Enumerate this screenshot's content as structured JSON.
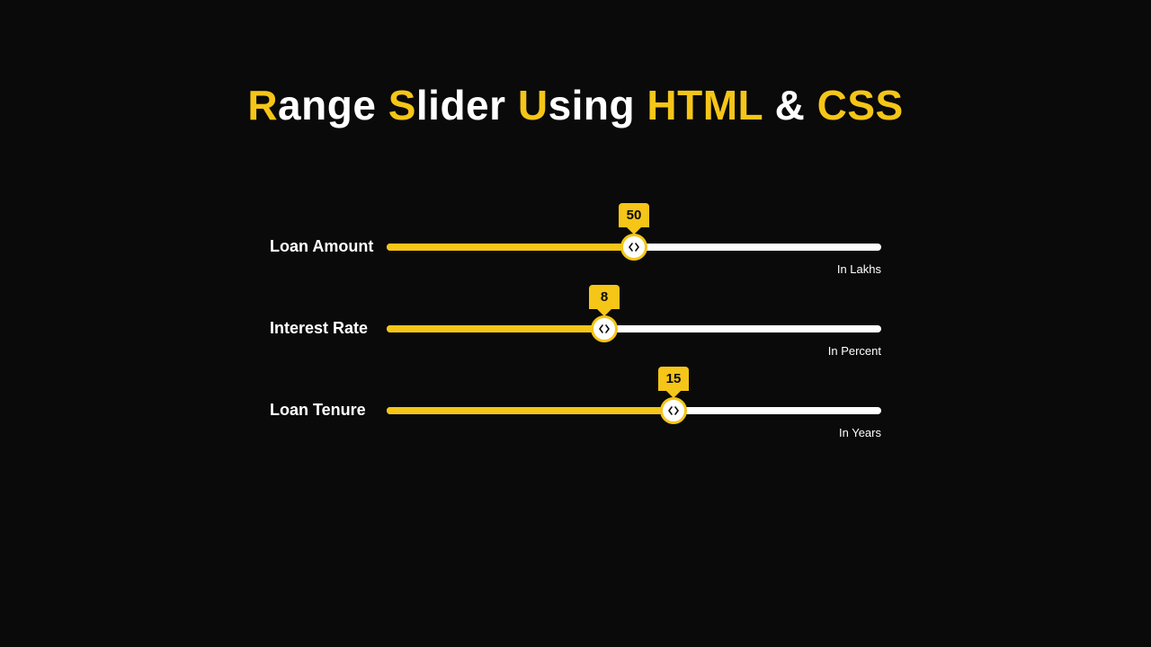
{
  "title": {
    "parts": [
      {
        "text": "R",
        "class": "accent"
      },
      {
        "text": "ange ",
        "class": "white"
      },
      {
        "text": "S",
        "class": "accent"
      },
      {
        "text": "lider ",
        "class": "white"
      },
      {
        "text": "U",
        "class": "accent"
      },
      {
        "text": "sing ",
        "class": "white"
      },
      {
        "text": "HTML",
        "class": "accent"
      },
      {
        "text": " & ",
        "class": "white"
      },
      {
        "text": "CSS",
        "class": "accent"
      }
    ]
  },
  "colors": {
    "accent": "#f5c518",
    "background": "#0a0a0a",
    "track": "#ffffff"
  },
  "sliders": [
    {
      "label": "Loan Amount",
      "value": "50",
      "percent": 50,
      "unit": "In Lakhs"
    },
    {
      "label": "Interest Rate",
      "value": "8",
      "percent": 44,
      "unit": "In Percent"
    },
    {
      "label": "Loan Tenure",
      "value": "15",
      "percent": 58,
      "unit": "In Years"
    }
  ]
}
